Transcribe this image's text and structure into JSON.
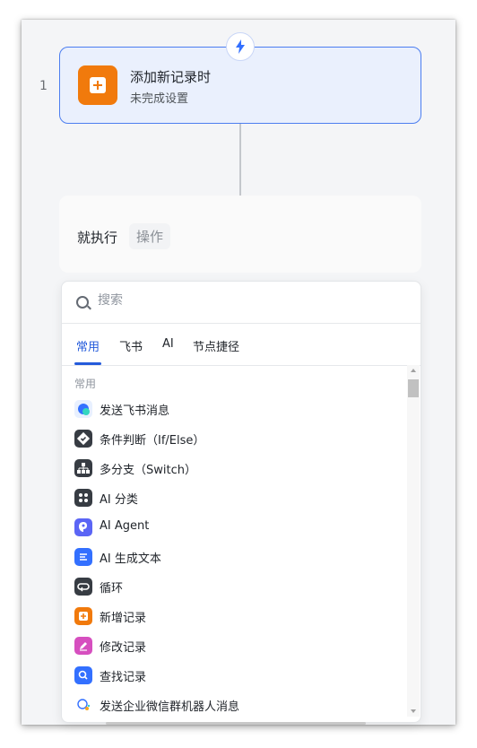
{
  "flow": {
    "line_number": "1",
    "trigger": {
      "title": "添加新记录时",
      "subtitle": "未完成设置",
      "icon": "add-record-icon",
      "color": "#f17a0c"
    },
    "trigger_badge_icon": "lightning-icon",
    "action": {
      "label": "就执行",
      "chip": "操作"
    }
  },
  "picker": {
    "search": {
      "placeholder": "搜索",
      "value": ""
    },
    "tabs": [
      {
        "label": "常用",
        "active": true
      },
      {
        "label": "飞书",
        "active": false
      },
      {
        "label": "AI",
        "active": false
      },
      {
        "label": "节点捷径",
        "active": false
      }
    ],
    "section_title": "常用",
    "items": [
      {
        "label": "发送飞书消息",
        "icon": "feishu-message-icon",
        "color": "#e8f0ff"
      },
      {
        "label": "条件判断（If/Else）",
        "icon": "condition-icon",
        "color": "#373c43"
      },
      {
        "label": "多分支（Switch）",
        "icon": "branch-icon",
        "color": "#373c43"
      },
      {
        "label": "AI 分类",
        "icon": "ai-classify-icon",
        "color": "#373c43"
      },
      {
        "label": "AI Agent",
        "icon": "ai-agent-icon",
        "color": "#5b65f5"
      },
      {
        "label": "AI 生成文本",
        "icon": "ai-text-icon",
        "color": "#3370ff"
      },
      {
        "label": "循环",
        "icon": "loop-icon",
        "color": "#373c43"
      },
      {
        "label": "新增记录",
        "icon": "add-record-icon",
        "color": "#f17a0c"
      },
      {
        "label": "修改记录",
        "icon": "edit-record-icon",
        "color": "#d64fbf"
      },
      {
        "label": "查找记录",
        "icon": "find-record-icon",
        "color": "#3370ff"
      },
      {
        "label": "发送企业微信群机器人消息",
        "icon": "wecom-bot-icon",
        "color": "#ffffff"
      }
    ]
  }
}
